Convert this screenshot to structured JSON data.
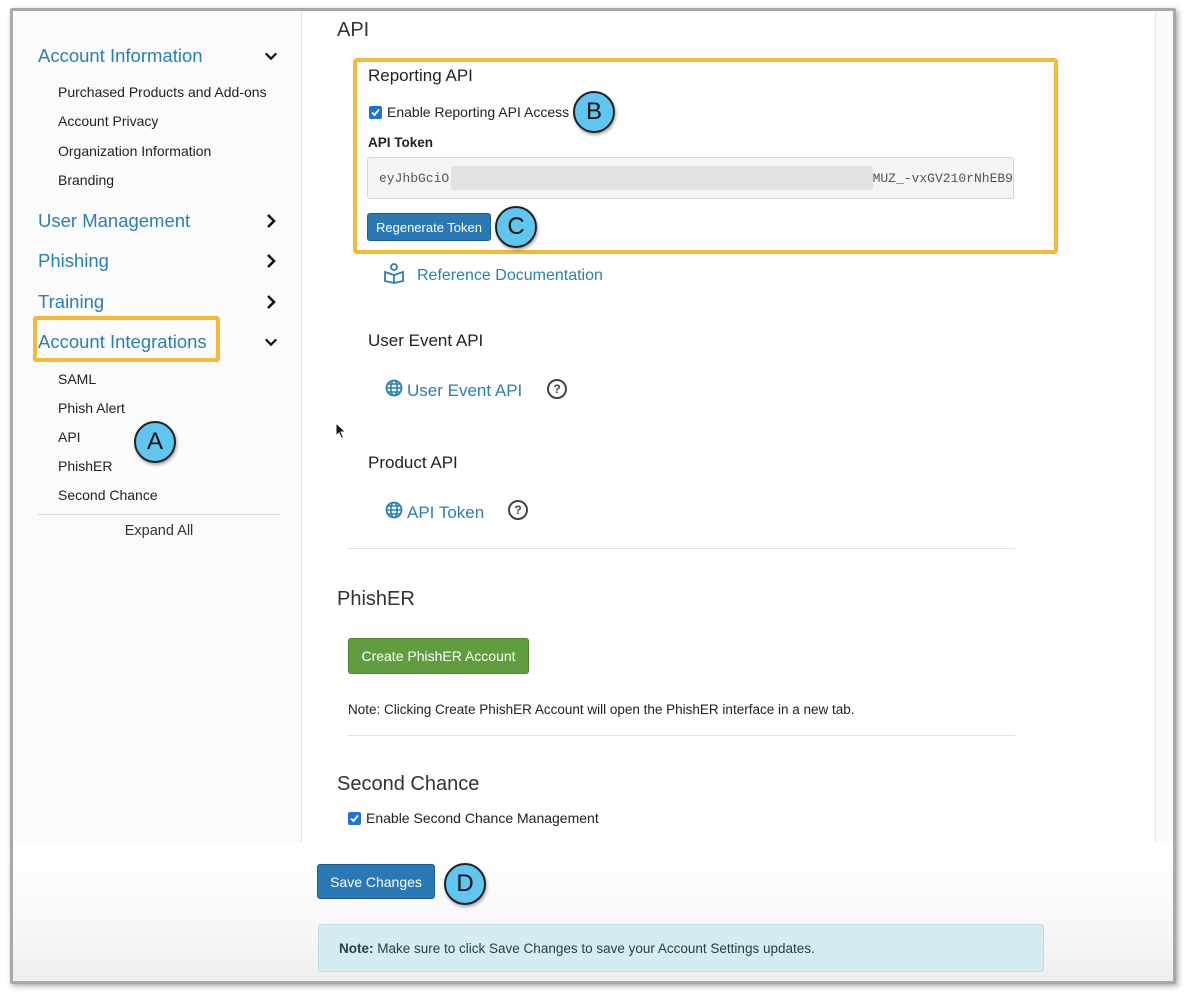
{
  "sidebar": {
    "account_information": {
      "label": "Account Information",
      "items": [
        "Purchased Products and Add-ons",
        "Account Privacy",
        "Organization Information",
        "Branding"
      ]
    },
    "user_management": "User Management",
    "phishing": "Phishing",
    "training": "Training",
    "account_integrations": {
      "label": "Account Integrations",
      "items": [
        "SAML",
        "Phish Alert",
        "API",
        "PhishER",
        "Second Chance"
      ]
    },
    "expand_all": "Expand All"
  },
  "main": {
    "api_heading": "API",
    "reporting_api": {
      "title": "Reporting API",
      "enable_label": "Enable Reporting API Access",
      "enable_checked": true,
      "token_label": "API Token",
      "token_prefix": "eyJhbGciO",
      "token_suffix": "MUZ_-vxGV210rNhEB9",
      "regenerate_label": "Regenerate Token"
    },
    "reference_documentation": "Reference Documentation",
    "user_event_api": {
      "title": "User Event API",
      "link": "User Event API",
      "help": "?"
    },
    "product_api": {
      "title": "Product API",
      "link": "API Token",
      "help": "?"
    },
    "phisher": {
      "heading": "PhishER",
      "create_label": "Create PhishER Account",
      "note": "Note: Clicking Create PhishER Account will open the PhishER interface in a new tab."
    },
    "second_chance": {
      "heading": "Second Chance",
      "enable_label": "Enable Second Chance Management",
      "enable_checked": true
    },
    "save_changes": "Save Changes",
    "footer_note": {
      "strong": "Note:",
      "text": " Make sure to click Save Changes to save your Account Settings updates."
    }
  },
  "callouts": {
    "a": "A",
    "b": "B",
    "c": "C",
    "d": "D"
  },
  "colors": {
    "link": "#2a7fb3",
    "highlight": "#f5b93a",
    "callout": "#5ec6ef",
    "primary_button": "#2b79b4",
    "success_button": "#5f9d3e",
    "info_box": "#d6ecf3"
  }
}
